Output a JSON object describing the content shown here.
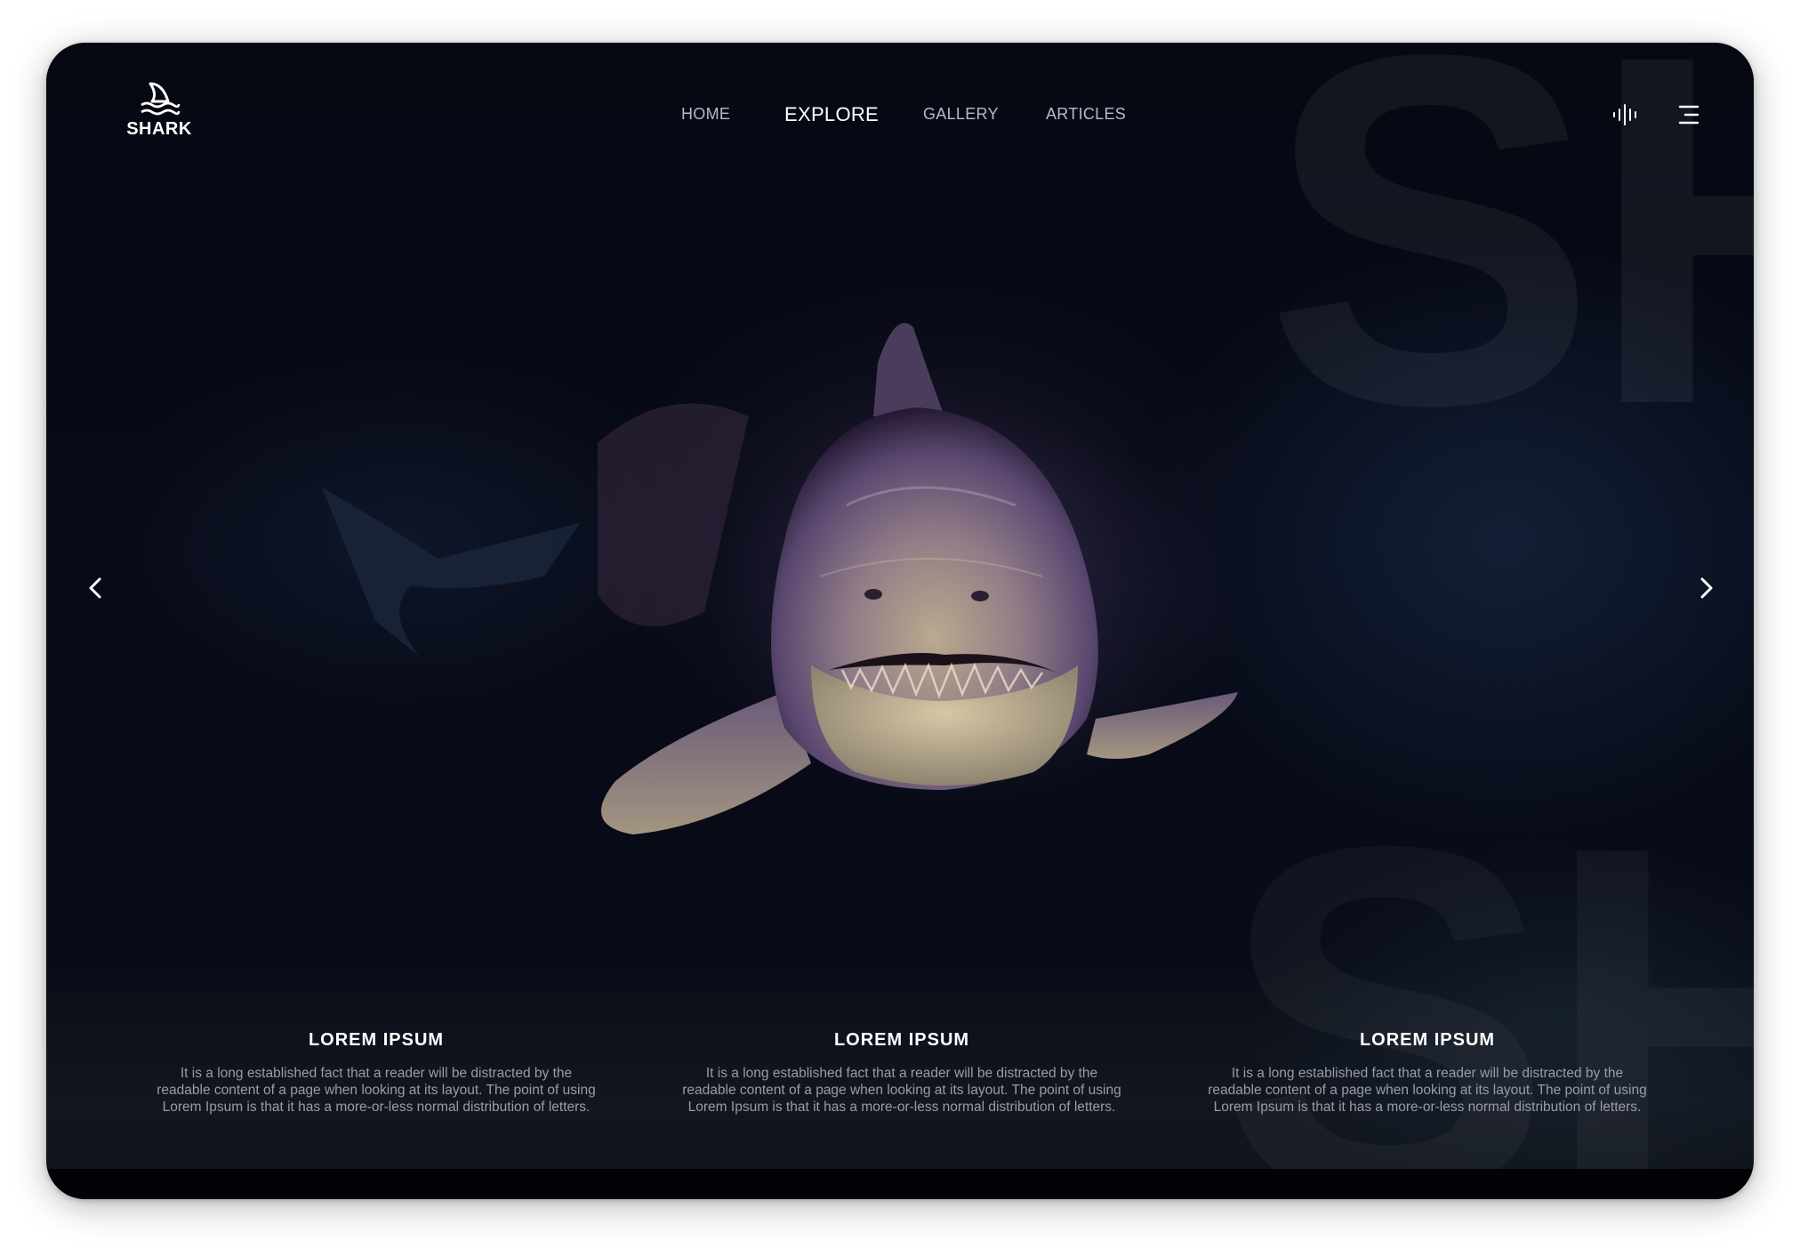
{
  "brand": {
    "name": "SHARK",
    "icon": "shark-fin-logo-icon"
  },
  "nav": {
    "items": [
      {
        "label": "HOME",
        "active": false
      },
      {
        "label": "EXPLORE",
        "active": true
      },
      {
        "label": "GALLERY",
        "active": false
      },
      {
        "label": "ARTICLES",
        "active": false
      }
    ]
  },
  "header_icons": {
    "audio": "sound-wave-icon",
    "menu": "hamburger-menu-icon"
  },
  "slider": {
    "prev_icon": "chevron-left-icon",
    "next_icon": "chevron-right-icon"
  },
  "watermark": {
    "top": "SH",
    "bottom": "SH"
  },
  "hero_image": "shark-photo",
  "info": [
    {
      "title": "LOREM IPSUM",
      "body": "It is a long established fact that a reader will be distracted by the readable content of a page when looking at its layout. The point of using Lorem Ipsum is that it has a more-or-less normal distribution of letters."
    },
    {
      "title": "LOREM IPSUM",
      "body": "It is a long established fact that a reader will be distracted by the readable content of a page when looking at its layout. The point of using Lorem Ipsum is that it has a more-or-less normal distribution of letters."
    },
    {
      "title": "LOREM IPSUM",
      "body": "It is a long established fact that a reader will be distracted by the readable content of a page when looking at its layout. The point of using Lorem Ipsum is that it has a more-or-less normal distribution of letters."
    }
  ],
  "colors": {
    "background": "#05070f",
    "text": "#ffffff",
    "muted": "#9a9ca8",
    "nav": "#b8b9c8"
  }
}
